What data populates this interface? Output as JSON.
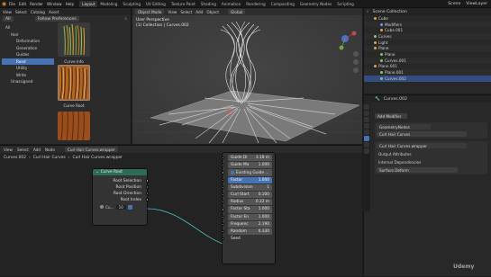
{
  "topbar": {
    "menu": [
      "File",
      "Edit",
      "Render",
      "Window",
      "Help"
    ],
    "workspaces": [
      "Layout",
      "Modeling",
      "Sculpting",
      "UV Editing",
      "Texture Paint",
      "Shading",
      "Animation",
      "Rendering",
      "Compositing",
      "Geometry Nodes",
      "Scripting"
    ],
    "active_workspace": "Layout",
    "scene": "Scene",
    "view_layer": "ViewLayer"
  },
  "asset_browser": {
    "menu": [
      "View",
      "Select",
      "Catalog",
      "Asset"
    ],
    "library": "All",
    "import_mode": "Follow Preferences",
    "catalogs": [
      {
        "label": "All",
        "level": 0,
        "selected": false
      },
      {
        "label": "Hair",
        "level": 1,
        "selected": false
      },
      {
        "label": "Deformation",
        "level": 2,
        "selected": false
      },
      {
        "label": "Generation",
        "level": 2,
        "selected": false
      },
      {
        "label": "Guides",
        "level": 2,
        "selected": false
      },
      {
        "label": "Read",
        "level": 2,
        "selected": true
      },
      {
        "label": "Utility",
        "level": 2,
        "selected": false
      },
      {
        "label": "Write",
        "level": 2,
        "selected": false
      },
      {
        "label": "Unassigned",
        "level": 1,
        "selected": false
      }
    ],
    "thumbs": [
      {
        "label": "Curve Info"
      },
      {
        "label": "Curve Root"
      },
      {
        "label": ""
      }
    ]
  },
  "viewport": {
    "mode": "Object Mode",
    "menu": [
      "View",
      "Select",
      "Add",
      "Object"
    ],
    "orientation": "Global",
    "overlay_title": "User Perspective",
    "overlay_sub": "(1) Collection | Curves.002"
  },
  "outliner": {
    "title": "Scene Collection",
    "rows": [
      {
        "label": "Cube",
        "indent": 1,
        "color": "#e8a23d",
        "selected": false
      },
      {
        "label": "Modifiers",
        "indent": 2,
        "color": "#6a9be8",
        "selected": false
      },
      {
        "label": "Cube.001",
        "indent": 2,
        "color": "#e8a23d",
        "selected": false
      },
      {
        "label": "Curves",
        "indent": 1,
        "color": "#88c27a",
        "selected": false
      },
      {
        "label": "Light",
        "indent": 1,
        "color": "#e8a23d",
        "selected": false
      },
      {
        "label": "Plane",
        "indent": 1,
        "color": "#e8a23d",
        "selected": false
      },
      {
        "label": "Plane",
        "indent": 2,
        "color": "#88c27a",
        "selected": false
      },
      {
        "label": "Curves.001",
        "indent": 2,
        "color": "#88c27a",
        "selected": false
      },
      {
        "label": "Plane.001",
        "indent": 1,
        "color": "#e8a23d",
        "selected": false
      },
      {
        "label": "Plane.001",
        "indent": 2,
        "color": "#88c27a",
        "selected": false
      },
      {
        "label": "Curves.002",
        "indent": 2,
        "color": "#88c27a",
        "selected": true
      }
    ]
  },
  "properties": {
    "object_name": "Curves.002",
    "add_modifier": "Add Modifier",
    "modifiers": [
      {
        "name": "GeometryNodes",
        "group": "Curl Hair Curves"
      },
      {
        "name": "Curl Hair Curves.wrapper",
        "group": ""
      }
    ],
    "panels": [
      "Output Attributes",
      "Internal Dependencies"
    ],
    "surface_field": "Surface Deform"
  },
  "node_editor": {
    "menu": [
      "View",
      "Select",
      "Add",
      "Node"
    ],
    "tree_name": "Curl Hair Curves.wrapper",
    "breadcrumb": [
      "Curves.002",
      "Curl Hair Curves",
      "Curl Hair Curves.wrapper"
    ],
    "curve_root_node": {
      "title": "Curve Root",
      "outputs": [
        "Root Selection",
        "Root Position",
        "Root Direction",
        "Root Index"
      ],
      "count_label": "Cu...",
      "count_value": "10"
    },
    "group_inputs": [
      {
        "label": "Guide Di",
        "value": "3.18 m",
        "highlight": false
      },
      {
        "label": "Guide Ma",
        "value": "1.000",
        "highlight": false
      },
      {
        "label": "Existing Guide ...",
        "value": "",
        "highlight": false,
        "checkbox": true
      },
      {
        "label": "Factor",
        "value": "1.000",
        "highlight": true
      },
      {
        "label": "Subdivision",
        "value": "1",
        "highlight": false
      },
      {
        "label": "Curl Start",
        "value": "0.100",
        "highlight": false
      },
      {
        "label": "Radius",
        "value": "0.22 m",
        "highlight": false
      },
      {
        "label": "Factor Sta",
        "value": "1.000",
        "highlight": false
      },
      {
        "label": "Factor En",
        "value": "1.000",
        "highlight": false
      },
      {
        "label": "Frequenc",
        "value": "2.190",
        "highlight": false
      },
      {
        "label": "Random",
        "value": "0.330",
        "highlight": false
      },
      {
        "label": "Seed",
        "value": "",
        "highlight": false
      }
    ]
  },
  "watermark": "Udemy"
}
